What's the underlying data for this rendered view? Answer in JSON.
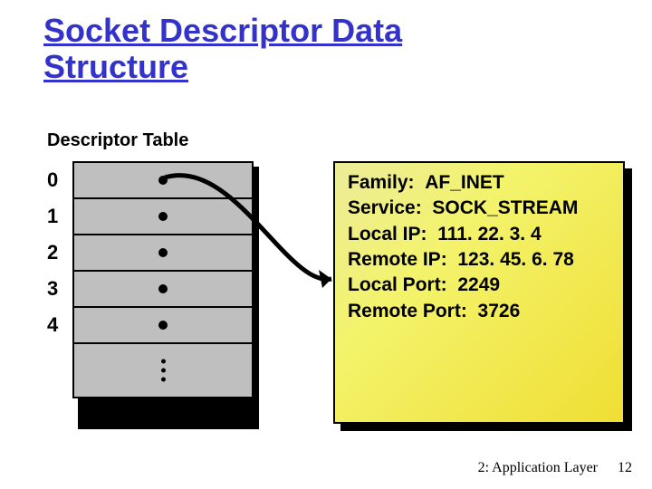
{
  "title": "Socket Descriptor Data\nStructure",
  "subtitle": "Descriptor Table",
  "indices": [
    "0",
    "1",
    "2",
    "3",
    "4"
  ],
  "detail": {
    "family_label": "Family:",
    "family_value": "AF_INET",
    "service_label": "Service:",
    "service_value": "SOCK_STREAM",
    "localip_label": "Local IP:",
    "localip_value": "111. 22. 3. 4",
    "remoteip_label": "Remote IP:",
    "remoteip_value": "123. 45. 6. 78",
    "localport_label": "Local Port:",
    "localport_value": "2249",
    "remoteport_label": "Remote Port:",
    "remoteport_value": "3726"
  },
  "footer": {
    "chapter": "2: Application Layer",
    "page": "12"
  }
}
